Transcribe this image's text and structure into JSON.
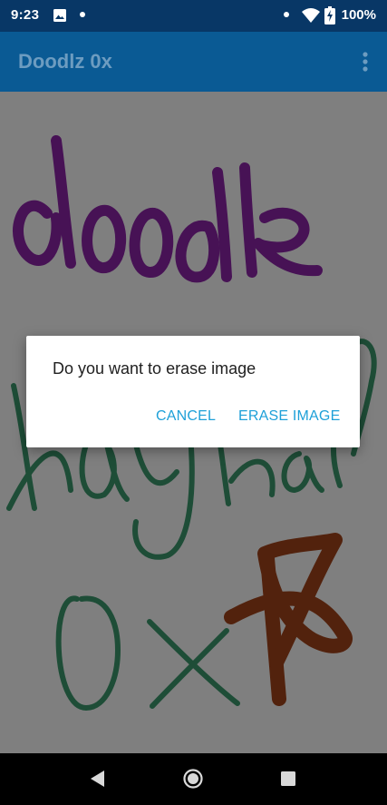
{
  "status_bar": {
    "time": "9:23",
    "battery": "100%",
    "icons": [
      "image-notification-icon",
      "dot-icon",
      "dot-icon",
      "wifi-icon",
      "battery-charging-icon"
    ]
  },
  "app_bar": {
    "title": "Doodlz 0x",
    "menu_icon": "more-vert-icon"
  },
  "dialog": {
    "message": "Do you want to erase image",
    "cancel_label": "CANCEL",
    "erase_label": "ERASE IMAGE",
    "button_color": "#1ea0d8"
  },
  "canvas": {
    "stroke_colors": {
      "purple": "#8e24aa",
      "green": "#3c9b6f",
      "brown": "#a5441b"
    }
  },
  "nav_bar": {
    "icons": [
      "back-icon",
      "home-icon",
      "recents-icon"
    ]
  }
}
